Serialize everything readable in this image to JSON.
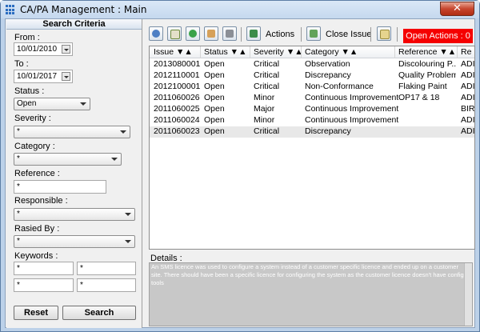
{
  "window": {
    "title": "CA/PA Management : Main",
    "close_glyph": "✕"
  },
  "search": {
    "header": "Search Criteria",
    "from_label": "From :",
    "from_value": "10/01/2010",
    "to_label": "To :",
    "to_value": "10/01/2017",
    "status_label": "Status :",
    "status_value": "Open",
    "severity_label": "Severity :",
    "severity_value": "*",
    "category_label": "Category :",
    "category_value": "*",
    "reference_label": "Reference :",
    "reference_value": "*",
    "responsible_label": "Responsible :",
    "responsible_value": "*",
    "raised_label": "Rasied By :",
    "raised_value": "*",
    "keywords_label": "Keywords :",
    "keywords": [
      "*",
      "*",
      "*",
      "*"
    ],
    "reset_label": "Reset",
    "search_label": "Search"
  },
  "toolbar": {
    "actions_label": "Actions",
    "close_issue_label": "Close Issue",
    "open_actions_label": "Open Actions : 0",
    "open_actions_color": "#f50000"
  },
  "grid": {
    "columns": [
      "Issue ▼▲",
      "Status ▼▲",
      "Severity ▼▲",
      "Category ▼▲",
      "Reference ▼▲",
      "Re"
    ],
    "rows": [
      [
        "2013080001",
        "Open",
        "Critical",
        "Observation",
        "Discolouring P...",
        "ADI"
      ],
      [
        "2012110001",
        "Open",
        "Critical",
        "Discrepancy",
        "Quality Problem",
        "ADI"
      ],
      [
        "2012100001",
        "Open",
        "Critical",
        "Non-Conformance",
        "Flaking Paint",
        "ADI"
      ],
      [
        "2011060026",
        "Open",
        "Minor",
        "Continuous Improvement",
        "OP17 & 18",
        "ADI"
      ],
      [
        "2011060025",
        "Open",
        "Major",
        "Continuous Improvement",
        "",
        "BIR"
      ],
      [
        "2011060024",
        "Open",
        "Minor",
        "Continuous Improvement",
        "",
        "ADI"
      ],
      [
        "2011060023",
        "Open",
        "Critical",
        "Discrepancy",
        "",
        "ADI"
      ]
    ],
    "selected_row": 6
  },
  "details": {
    "label": "Details :",
    "text": "An SMS licence was used to configure a system instead of a customer specific licence and ended up on a customer site. There should have been a specific licence for configuring the system as the customer licence doesn't have config tools"
  }
}
